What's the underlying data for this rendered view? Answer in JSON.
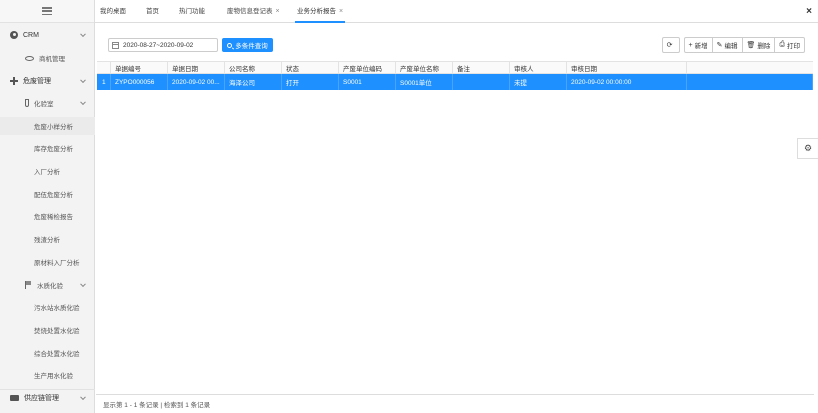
{
  "sidebar": {
    "items": [
      {
        "label": "CRM",
        "icon": "user-icon",
        "level": 1
      },
      {
        "label": "商机管理",
        "icon": "eye-icon",
        "level": 2
      },
      {
        "label": "危废管理",
        "icon": "plus-cross-icon",
        "level": 1
      },
      {
        "label": "化验室",
        "icon": "test-tube-icon",
        "level": 2
      },
      {
        "label": "危废小样分析",
        "level": 3
      },
      {
        "label": "库存危废分析",
        "level": 3
      },
      {
        "label": "入厂分析",
        "level": 3
      },
      {
        "label": "配伍危废分析",
        "level": 3
      },
      {
        "label": "危废稀检报告",
        "level": 3
      },
      {
        "label": "残渣分析",
        "level": 3
      },
      {
        "label": "原材料入厂分析",
        "level": 3
      },
      {
        "label": "水质化验",
        "icon": "flag-icon",
        "level": 2
      },
      {
        "label": "污水站水质化验",
        "level": 3
      },
      {
        "label": "焚烧处置水化验",
        "level": 3
      },
      {
        "label": "综合处置水化验",
        "level": 3
      },
      {
        "label": "生产用水化验",
        "level": 3
      },
      {
        "label": "供应链管理",
        "icon": "truck-icon",
        "level": 1
      }
    ]
  },
  "tabs": [
    {
      "label": "我的桌面",
      "closable": false
    },
    {
      "label": "首页",
      "closable": false
    },
    {
      "label": "热门功能",
      "closable": false
    },
    {
      "label": "废物信息登记表",
      "closable": true
    },
    {
      "label": "业务分析报告",
      "closable": true,
      "active": true
    }
  ],
  "tab_close_all": "×",
  "filter": {
    "date_range": "2020-08-27~2020-09-02",
    "search_label": "多条件查询"
  },
  "toolbar": {
    "refresh_icon": "⟳",
    "add_label": "新增",
    "edit_label": "编辑",
    "delete_label": "删除",
    "print_label": "打印"
  },
  "table": {
    "columns": [
      "",
      "单据编号",
      "单据日期",
      "公司名称",
      "状态",
      "产废单位编码",
      "产废单位名称",
      "备注",
      "审核人",
      "审核日期",
      ""
    ],
    "rows": [
      [
        "1",
        "ZYPO000056",
        "2020-09-02 00...",
        "海泽公司",
        "打开",
        "S0001",
        "S0001单位",
        "",
        "未提",
        "2020-09-02 00:00:00",
        ""
      ]
    ]
  },
  "footer": {
    "summary": "显示第 1 - 1 条记录 | 检索到 1 条记录"
  },
  "colors": {
    "accent": "#1e90ff",
    "sidebar_bg": "#f3f3f3"
  }
}
